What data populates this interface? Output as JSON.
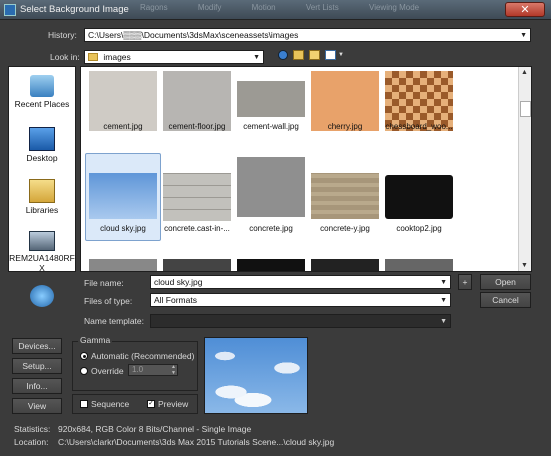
{
  "window": {
    "title": "Select Background Image",
    "close": "✕",
    "bg_tabs": [
      "Ragons",
      "Modify",
      "Motion",
      "Vert Lists",
      "Viewing Mode"
    ]
  },
  "history": {
    "label": "History:",
    "value": "C:\\Users\\▒▒▒\\Documents\\3dsMax\\sceneassets\\images"
  },
  "lookin": {
    "label": "Look in:",
    "value": "images"
  },
  "places": [
    {
      "label": "Recent Places"
    },
    {
      "label": "Desktop"
    },
    {
      "label": "Libraries"
    },
    {
      "label": "REM2UA1480RF X"
    },
    {
      "label": ""
    }
  ],
  "files": [
    {
      "name": "cement.jpg",
      "color": "#cfcbc5"
    },
    {
      "name": "cement-floor.jpg",
      "color": "#b7b5b2"
    },
    {
      "name": "cement-wall.jpg",
      "color": "#9c9a94"
    },
    {
      "name": "cherry.jpg",
      "color": "#e8a26a"
    },
    {
      "name": "chessboard_woo...",
      "color": "#9a5a2a"
    },
    {
      "name": "cloud sky.jpg",
      "color": "#6ea2df"
    },
    {
      "name": "concrete.cast-in-...",
      "color": "#c2c1bc"
    },
    {
      "name": "concrete.jpg",
      "color": "#8f8f8f"
    },
    {
      "name": "concrete-y.jpg",
      "color": "#a7967a"
    },
    {
      "name": "cooktop2.jpg",
      "color": "#111111"
    }
  ],
  "form": {
    "filename_label": "File name:",
    "filename_value": "cloud sky.jpg",
    "filetype_label": "Files of type:",
    "filetype_value": "All Formats",
    "template_label": "Name template:",
    "template_value": "",
    "plus": "+",
    "open": "Open",
    "cancel": "Cancel"
  },
  "left_buttons": {
    "devices": "Devices...",
    "setup": "Setup...",
    "info": "Info...",
    "view": "View"
  },
  "gamma": {
    "title": "Gamma",
    "automatic": "Automatic (Recommended)",
    "override": "Override",
    "override_value": "1.0"
  },
  "options": {
    "sequence": "Sequence",
    "preview": "Preview"
  },
  "stats": {
    "label": "Statistics:",
    "value": "920x684, RGB Color 8 Bits/Channel - Single Image"
  },
  "location": {
    "label": "Location:",
    "value": "C:\\Users\\clarkr\\Documents\\3ds Max 2015 Tutorials Scene...\\cloud sky.jpg"
  }
}
